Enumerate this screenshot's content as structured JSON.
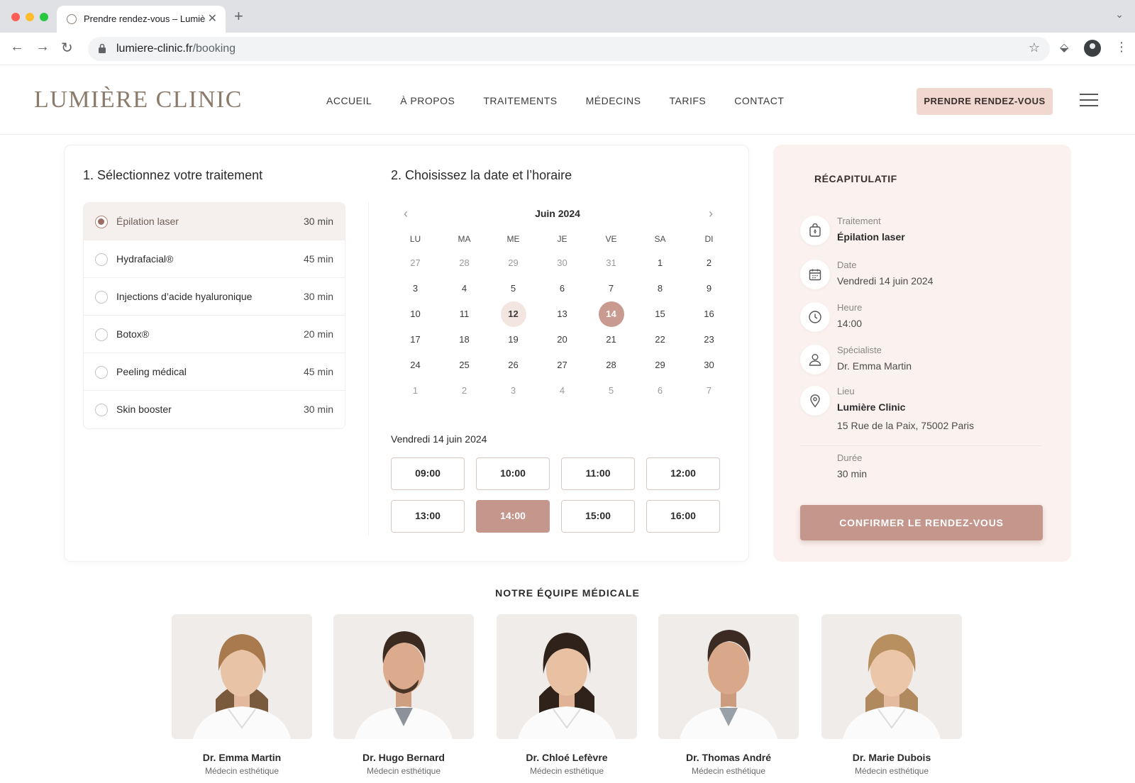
{
  "browser": {
    "tab_title": "Prendre rendez-vous – Lumière Clinic",
    "url_host": "lumiere-clinic.fr",
    "url_path": "/booking"
  },
  "header": {
    "logo": "LUMIÈRE CLINIC",
    "nav": [
      "ACCUEIL",
      "À PROPOS",
      "TRAITEMENTS",
      "MÉDECINS",
      "TARIFS",
      "CONTACT"
    ],
    "cta": "PRENDRE RENDEZ-VOUS"
  },
  "booking": {
    "step1_title": "1. Sélectionnez votre traitement",
    "treatments": [
      {
        "name": "Épilation laser",
        "duration": "30 min",
        "selected": true
      },
      {
        "name": "Hydrafacial®",
        "duration": "45 min",
        "selected": false
      },
      {
        "name": "Injections d’acide hyaluronique",
        "duration": "30 min",
        "selected": false
      },
      {
        "name": "Botox®",
        "duration": "20 min",
        "selected": false
      },
      {
        "name": "Peeling médical",
        "duration": "45 min",
        "selected": false
      },
      {
        "name": "Skin booster",
        "duration": "30 min",
        "selected": false
      }
    ],
    "step2_title": "2. Choisissez la date et l’horaire",
    "calendar": {
      "month": "Juin 2024",
      "weekdays": [
        "LU",
        "MA",
        "ME",
        "JE",
        "VE",
        "SA",
        "DI"
      ],
      "weeks": [
        [
          "27",
          "28",
          "29",
          "30",
          "31",
          "1",
          "2"
        ],
        [
          "3",
          "4",
          "5",
          "6",
          "7",
          "8",
          "9"
        ],
        [
          "10",
          "11",
          "12",
          "13",
          "14",
          "15",
          "16"
        ],
        [
          "17",
          "18",
          "19",
          "20",
          "21",
          "22",
          "23"
        ],
        [
          "24",
          "25",
          "26",
          "27",
          "28",
          "29",
          "30"
        ],
        [
          "1",
          "2",
          "3",
          "4",
          "5",
          "6",
          "7"
        ]
      ],
      "today": "12",
      "selected": "14"
    },
    "selected_date_label": "Vendredi 14 juin 2024",
    "slots": [
      "09:00",
      "10:00",
      "11:00",
      "12:00",
      "13:00",
      "14:00",
      "15:00",
      "16:00"
    ],
    "selected_slot": "14:00"
  },
  "summary": {
    "title": "RÉCAPITULATIF",
    "treatment_label": "Traitement",
    "treatment_value": "Épilation laser",
    "date_label": "Date",
    "date_value": "Vendredi 14 juin 2024",
    "time_label": "Heure",
    "time_value": "14:00",
    "specialist_label": "Spécialiste",
    "specialist_value": "Dr. Emma Martin",
    "location_label": "Lieu",
    "location_name": "Lumière Clinic",
    "location_address": "15 Rue de la Paix, 75002 Paris",
    "duration_label": "Durée",
    "duration_value": "30 min",
    "confirm": "CONFIRMER LE RENDEZ-VOUS"
  },
  "team": {
    "title": "NOTRE ÉQUIPE MÉDICALE",
    "doctors": [
      {
        "name": "Dr. Emma Martin",
        "role": "Médecin esthétique"
      },
      {
        "name": "Dr. Hugo Bernard",
        "role": "Médecin esthétique"
      },
      {
        "name": "Dr. Chloé Lefèvre",
        "role": "Médecin esthétique"
      },
      {
        "name": "Dr. Thomas André",
        "role": "Médecin esthétique"
      },
      {
        "name": "Dr. Marie Dubois",
        "role": "Médecin esthétique"
      }
    ]
  },
  "colors": {
    "accent": "#c4968c",
    "accent_light": "#f0d7d0",
    "summary_bg": "#fbf2ef",
    "logo": "#8c7a6b"
  }
}
